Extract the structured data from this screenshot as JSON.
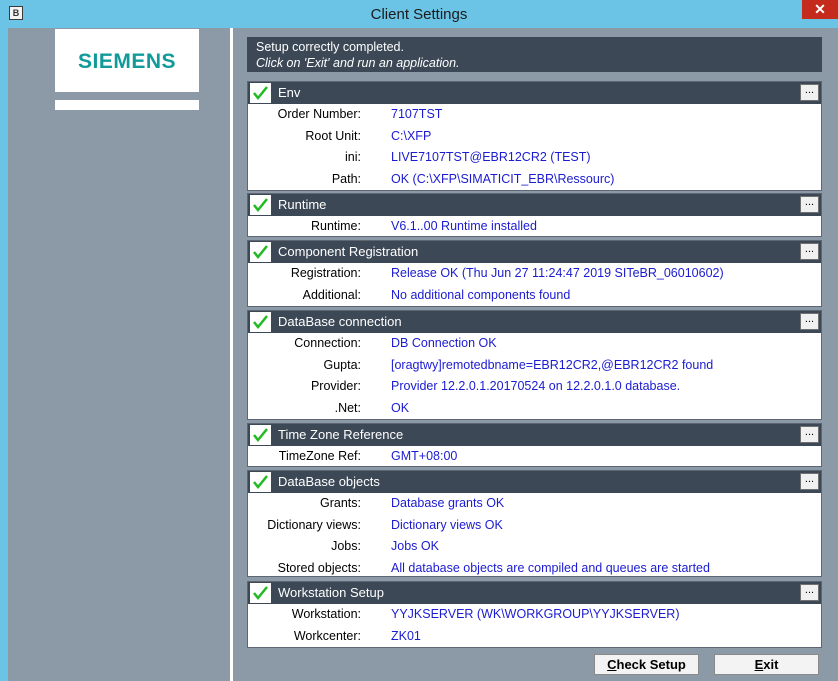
{
  "window": {
    "title": "Client Settings",
    "close_label": "✕"
  },
  "logo": {
    "text": "SIEMENS"
  },
  "status_message": {
    "line1": "Setup correctly completed.",
    "line2": "Click on 'Exit' and run an application."
  },
  "sections": [
    {
      "title": "Env",
      "more_label": "...",
      "rows": [
        {
          "label": "Order Number:",
          "value": "7107TST"
        },
        {
          "label": "Root Unit:",
          "value": "C:\\XFP"
        },
        {
          "label": "ini:",
          "value": "LIVE7107TST@EBR12CR2 (TEST)"
        },
        {
          "label": "Path:",
          "value": "OK (C:\\XFP\\SIMATICIT_EBR\\Ressourc)"
        }
      ]
    },
    {
      "title": "Runtime",
      "more_label": "...",
      "rows": [
        {
          "label": "Runtime:",
          "value": "V6.1..00 Runtime installed"
        }
      ]
    },
    {
      "title": "Component Registration",
      "more_label": "...",
      "rows": [
        {
          "label": "Registration:",
          "value": "Release OK (Thu Jun 27 11:24:47 2019  SITeBR_06010602)"
        },
        {
          "label": "Additional:",
          "value": "No additional components found"
        }
      ]
    },
    {
      "title": "DataBase connection",
      "more_label": "...",
      "rows": [
        {
          "label": "Connection:",
          "value": "DB Connection OK"
        },
        {
          "label": "Gupta:",
          "value": "[oragtwy]remotedbname=EBR12CR2,@EBR12CR2 found"
        },
        {
          "label": "Provider:",
          "value": "Provider 12.2.0.1.20170524 on 12.2.0.1.0 database."
        },
        {
          "label": ".Net:",
          "value": "OK"
        }
      ]
    },
    {
      "title": "Time Zone Reference",
      "more_label": "...",
      "rows": [
        {
          "label": "TimeZone Ref:",
          "value": "GMT+08:00"
        }
      ]
    },
    {
      "title": "DataBase objects",
      "more_label": "...",
      "rows": [
        {
          "label": "Grants:",
          "value": "Database grants OK"
        },
        {
          "label": "Dictionary views:",
          "value": "Dictionary views OK"
        },
        {
          "label": "Jobs:",
          "value": "Jobs OK"
        },
        {
          "label": "Stored objects:",
          "value": "All database objects are compiled and queues are started"
        }
      ]
    },
    {
      "title": "Workstation Setup",
      "more_label": "...",
      "rows": [
        {
          "label": "Workstation:",
          "value": "YYJKSERVER (WK\\WORKGROUP\\YYJKSERVER)"
        },
        {
          "label": "Workcenter:",
          "value": "ZK01"
        }
      ]
    }
  ],
  "buttons": {
    "check_setup": {
      "accel": "C",
      "rest": "heck Setup"
    },
    "exit": {
      "accel": "E",
      "rest": "xit"
    }
  },
  "colors": {
    "check": "#22b922",
    "value_text": "#1b1bd1",
    "header_bg": "#3c4856",
    "body_bg": "#8c99a6",
    "frame": "#6bc3e6"
  }
}
